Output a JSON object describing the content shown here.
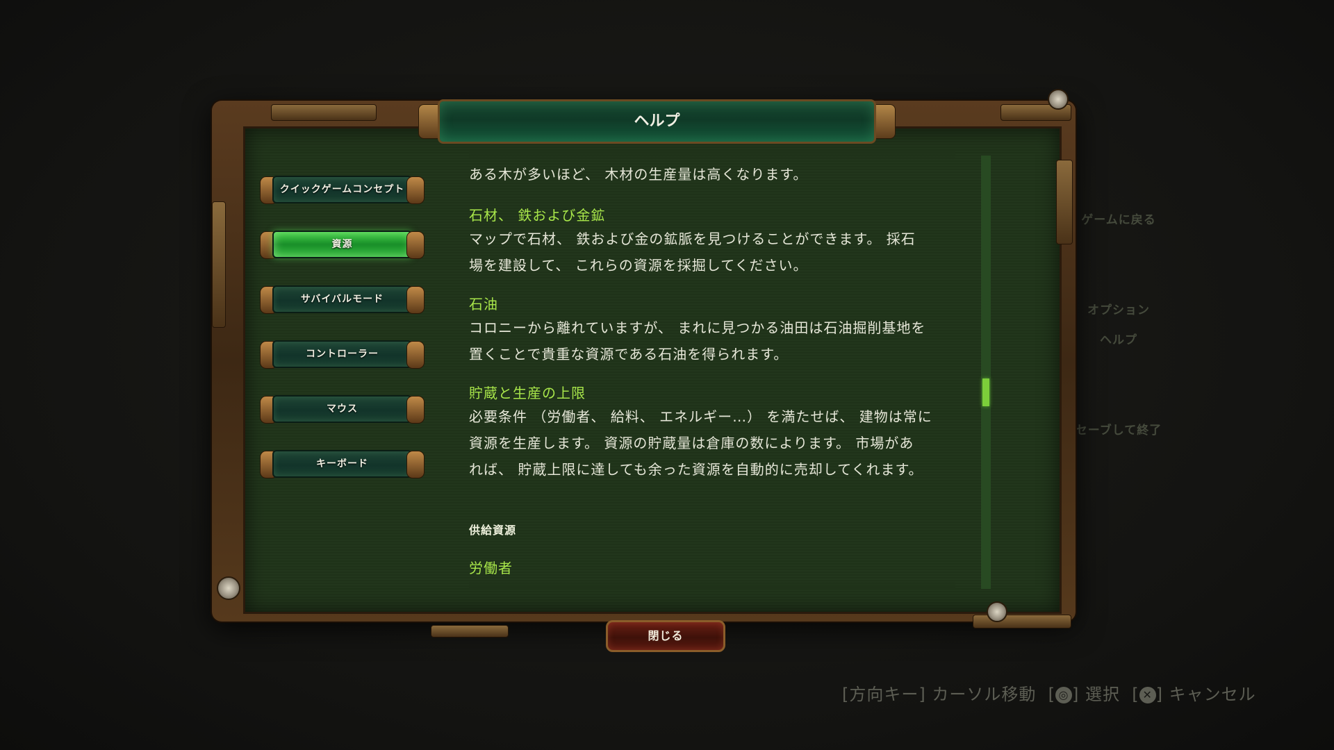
{
  "window": {
    "title": "ヘルプ"
  },
  "pause_menu": {
    "return_game": "ゲームに戻る",
    "options": "オプション",
    "help": "ヘルプ",
    "save_quit": "セーブして終了"
  },
  "nav": {
    "items": [
      {
        "label": "クイックゲームコンセプト",
        "active": false
      },
      {
        "label": "資源",
        "active": true
      },
      {
        "label": "サバイバルモード",
        "active": false
      },
      {
        "label": "コントローラー",
        "active": false
      },
      {
        "label": "マウス",
        "active": false
      },
      {
        "label": "キーボード",
        "active": false
      }
    ]
  },
  "content": {
    "line_top": "ある木が多いほど、 木材の生産量は高くなります。",
    "stone_heading": "石材、 鉄および金鉱",
    "stone_line1": "マップで石材、 鉄および金の鉱脈を見つけることができます。 採石",
    "stone_line2": "場を建設して、 これらの資源を採掘してください。",
    "oil_heading": "石油",
    "oil_line1": "コロニーから離れていますが、 まれに見つかる油田は石油掘削基地を",
    "oil_line2": "置くことで貴重な資源である石油を得られます。",
    "storage_heading": "貯蔵と生産の上限",
    "storage_line1": "必要条件 （労働者、 給料、 エネルギー…） を満たせば、 建物は常に",
    "storage_line2": "資源を生産します。 資源の貯蔵量は倉庫の数によります。 市場があ",
    "storage_line3": "れば、 貯蔵上限に達しても余った資源を自動的に売却してくれます。",
    "supply_section": "供給資源",
    "workers_heading": "労働者"
  },
  "scrollbar": {
    "position": 0.55
  },
  "close_button": {
    "label": "閉じる"
  },
  "hints": {
    "move": "[方向キー] カーソル移動",
    "select_open": "[",
    "select_close": "] 選択",
    "cancel_open": "[",
    "cancel_close": "] キャンセル",
    "circle_icon": "circle-button-icon",
    "cross_icon": "cross-button-icon"
  },
  "colors": {
    "accent_green": "#a8e64a",
    "active_button": "#3fcc44",
    "close_red": "#5a1a10"
  }
}
